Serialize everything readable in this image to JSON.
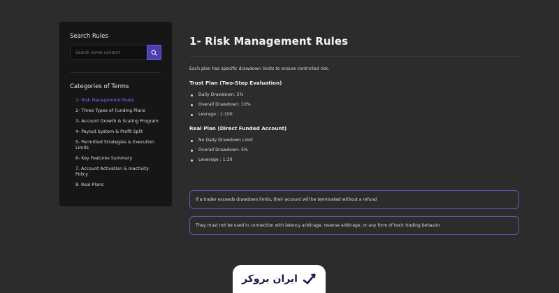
{
  "sidebar": {
    "search_heading": "Search Rules",
    "search_placeholder": "Search some content",
    "categories_heading": "Categories of Terms",
    "categories": [
      "1- Risk Management Rules",
      "2- Three Types of Funding Plans",
      "3- Account Growth & Scaling Program",
      "4- Payout System & Profit Split",
      "5- Permitted Strategies & Execution Limits",
      "6- Key Features Summary",
      "7. Account Activation & Inactivity Policy",
      "8. Real Plans"
    ]
  },
  "main": {
    "title": "1- Risk Management Rules",
    "intro": "Each plan has specific drawdown limits to ensure controlled risk.",
    "trust_plan": {
      "heading": "Trust Plan (Two-Step Evaluation)",
      "items": [
        "Daily Drawdown: 5%",
        "Overall Drawdown: 10%",
        "Levrage : 1:100"
      ]
    },
    "real_plan": {
      "heading": "Real Plan (Direct Funded Account)",
      "items": [
        "No Daily Drawdown Limit",
        "Overall Drawdown: 5%",
        "Leverage : 1:30"
      ]
    },
    "notices": [
      "If a trader exceeds drawdown limits, their account will be terminated without a refund",
      "They must not be used in connection with latency arbitrage, reverse arbitrage, or any form of toxic trading behavior"
    ]
  },
  "logo": {
    "text": "ایران بروکر"
  },
  "colors": {
    "accent": "#7a6df5",
    "button": "#4b3fb0",
    "notice_border": "#5f5ab4",
    "background": "#2c2c2d",
    "sidebar": "#161617"
  }
}
